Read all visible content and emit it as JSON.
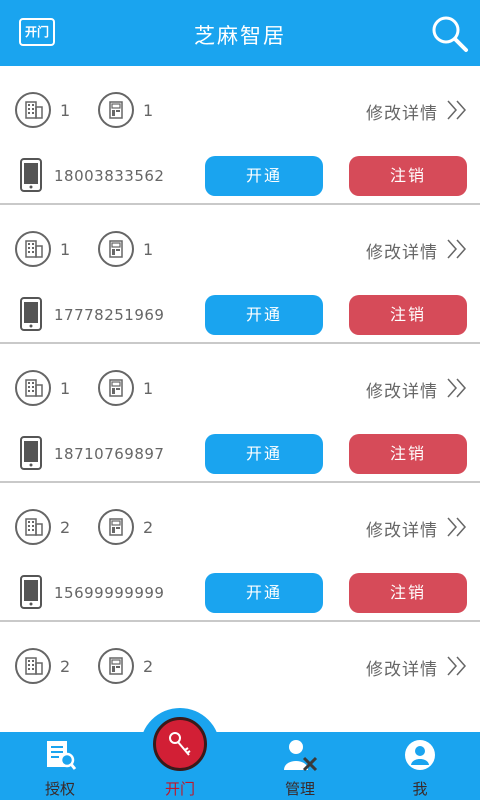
{
  "header": {
    "title": "芝麻智居",
    "open_badge": "开门",
    "search_icon": "search-icon"
  },
  "colors": {
    "primary": "#1aa4ef",
    "danger": "#d64b59",
    "active_tab": "#d21f35"
  },
  "entries": [
    {
      "building": "1",
      "room": "1",
      "edit": "修改详情",
      "phone": "18003833562",
      "open_label": "开通",
      "cancel_label": "注销"
    },
    {
      "building": "1",
      "room": "1",
      "edit": "修改详情",
      "phone": "17778251969",
      "open_label": "开通",
      "cancel_label": "注销"
    },
    {
      "building": "1",
      "room": "1",
      "edit": "修改详情",
      "phone": "18710769897",
      "open_label": "开通",
      "cancel_label": "注销"
    },
    {
      "building": "2",
      "room": "2",
      "edit": "修改详情",
      "phone": "15699999999",
      "open_label": "开通",
      "cancel_label": "注销"
    },
    {
      "building": "2",
      "room": "2",
      "edit": "修改详情"
    }
  ],
  "tabbar": {
    "tabs": [
      {
        "label": "授权",
        "icon": "authorize-icon"
      },
      {
        "label": "开门",
        "icon": "key-icon",
        "active": true
      },
      {
        "label": "管理",
        "icon": "manage-icon"
      },
      {
        "label": "我",
        "icon": "profile-icon"
      }
    ]
  }
}
